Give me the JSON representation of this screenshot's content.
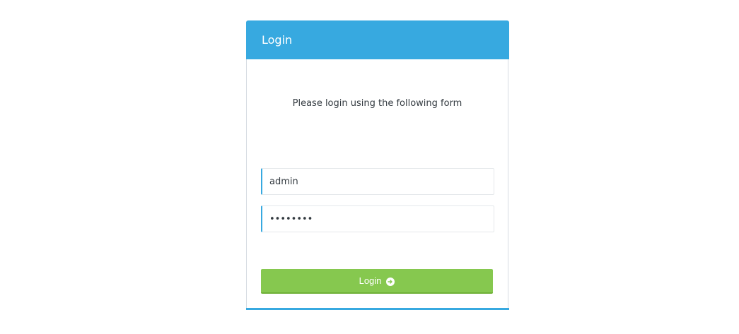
{
  "login_panel": {
    "title": "Login",
    "intro_text": "Please login using the following form",
    "username": {
      "value": "admin"
    },
    "password": {
      "value": "password"
    },
    "submit_label": "Login",
    "submit_icon": "arrow-circle-right-icon"
  },
  "colors": {
    "header": "#37a9e0",
    "accent": "#37a9e0",
    "button": "#86c84f"
  }
}
